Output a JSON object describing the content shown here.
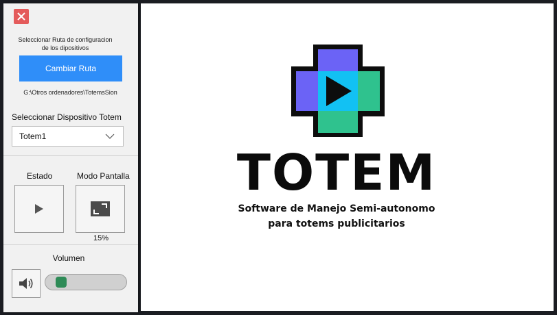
{
  "sidebar": {
    "route_label_line1": "Seleccionar Ruta de configuracion",
    "route_label_line2": "de los dipositivos",
    "change_route_label": "Cambiar Ruta",
    "route_path": "G:\\Otros ordenadores\\TotemsSion",
    "device_section_label": "Seleccionar Dispositivo Totem",
    "device_selected": "Totem1",
    "status_label": "Estado",
    "screen_mode_label": "Modo Pantalla",
    "screen_mode_value": "15%",
    "volume_label": "Volumen",
    "volume_level": 0.12
  },
  "main": {
    "brand_title": "TOTEM",
    "tagline_line1": "Software de Manejo Semi-autonomo",
    "tagline_line2": "para totems publicitarios"
  },
  "colors": {
    "accent_button": "#2f8ef9",
    "close_red": "#e45b5b",
    "logo_purple": "#6b63f6",
    "logo_cyan": "#12c1f3",
    "logo_green": "#2fc28e",
    "slider_thumb": "#2e8b57"
  },
  "icons": {
    "close": "close-icon",
    "dropdown": "chevron-down-icon",
    "play": "play-icon",
    "fullscreen": "fullscreen-icon",
    "volume": "speaker-icon"
  }
}
